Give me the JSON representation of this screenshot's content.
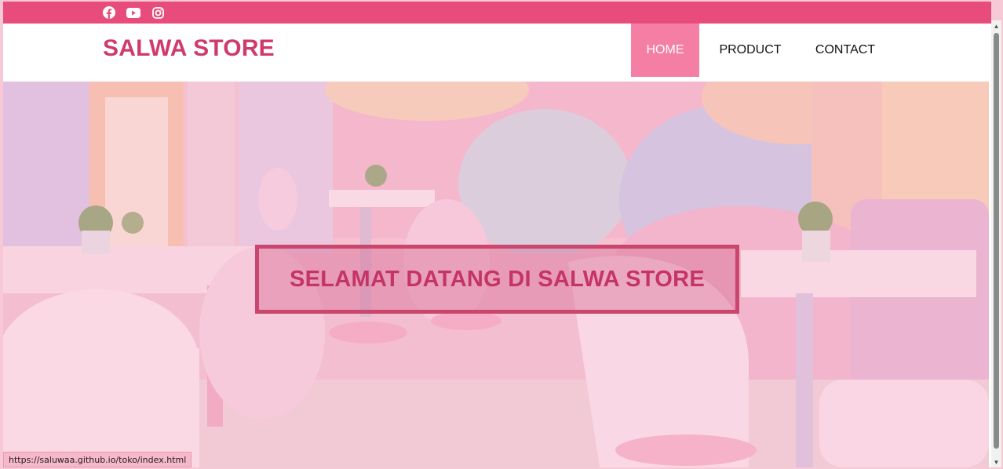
{
  "topbar": {
    "social_icons": [
      "facebook-icon",
      "youtube-icon",
      "instagram-icon"
    ],
    "background_color": "#e84c7d"
  },
  "navbar": {
    "brand": "SALWA STORE",
    "brand_color": "#cf3a6c",
    "items": [
      {
        "label": "HOME",
        "active": true
      },
      {
        "label": "PRODUCT",
        "active": false
      },
      {
        "label": "CONTACT",
        "active": false
      }
    ],
    "active_color": "#f57ea4"
  },
  "hero": {
    "welcome_text": "SELAMAT DATANG DI SALWA STORE",
    "accent_color": "#c43464"
  },
  "status_bar": {
    "url": "https://saluwaa.github.io/toko/index.html"
  }
}
